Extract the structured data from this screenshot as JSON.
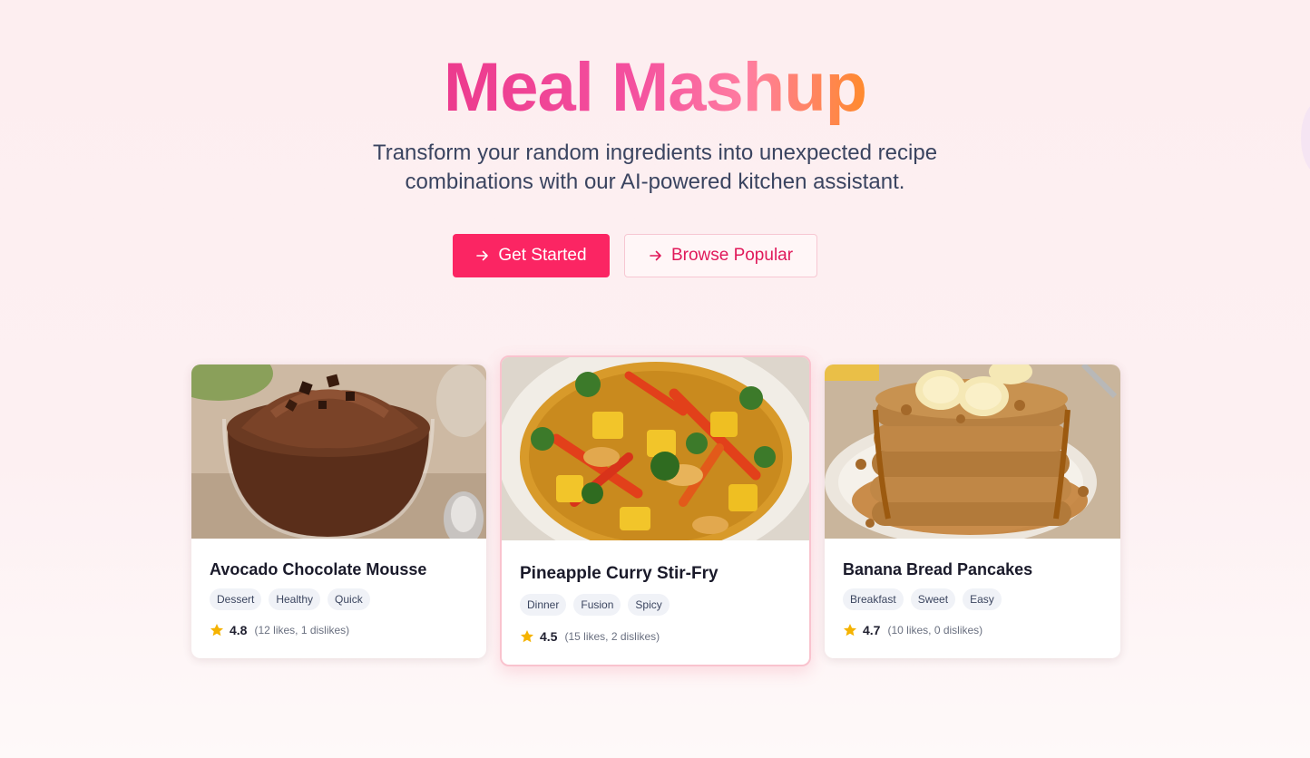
{
  "hero": {
    "title": "Meal Mashup",
    "subtitle": "Transform your random ingredients into unexpected recipe combinations with our AI-powered kitchen assistant.",
    "primary_cta": {
      "label": "Get Started",
      "icon": "arrow-right-icon"
    },
    "secondary_cta": {
      "label": "Browse Popular",
      "icon": "arrow-right-icon"
    }
  },
  "colors": {
    "title_gradient": [
      "#ec3a8d",
      "#f4509f",
      "#ff7ea0",
      "#ff8a2c"
    ],
    "primary": "#fb2563",
    "star": "#f5b301"
  },
  "recipes": [
    {
      "title": "Avocado Chocolate Mousse",
      "image": "chocolate-mousse-photo",
      "tags": [
        "Dessert",
        "Healthy",
        "Quick"
      ],
      "rating": "4.8",
      "votes": "(12 likes, 1 dislikes)"
    },
    {
      "title": "Pineapple Curry Stir-Fry",
      "image": "curry-stir-fry-photo",
      "tags": [
        "Dinner",
        "Fusion",
        "Spicy"
      ],
      "rating": "4.5",
      "votes": "(15 likes, 2 dislikes)",
      "featured": true
    },
    {
      "title": "Banana Bread Pancakes",
      "image": "banana-pancakes-photo",
      "tags": [
        "Breakfast",
        "Sweet",
        "Easy"
      ],
      "rating": "4.7",
      "votes": "(10 likes, 0 dislikes)"
    }
  ]
}
